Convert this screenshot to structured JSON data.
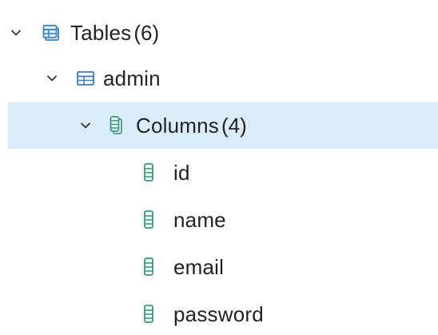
{
  "tree": {
    "tables_node": {
      "label": "Tables",
      "count": "(6)",
      "icon": "tables-icon",
      "expanded": true
    },
    "admin_node": {
      "label": "admin",
      "icon": "table-icon",
      "expanded": true
    },
    "columns_node": {
      "label": "Columns",
      "count": "(4)",
      "icon": "columns-icon",
      "expanded": true,
      "selected": true
    },
    "columns": [
      {
        "label": "id",
        "icon": "column-icon"
      },
      {
        "label": "name",
        "icon": "column-icon"
      },
      {
        "label": "email",
        "icon": "column-icon"
      },
      {
        "label": "password",
        "icon": "column-icon"
      }
    ]
  },
  "colors": {
    "selected_row_bg": "#d9ecf8",
    "table_icon": "#2f7dd6",
    "column_icon": "#2f9e78",
    "chevron": "#333333",
    "text": "#222222"
  }
}
